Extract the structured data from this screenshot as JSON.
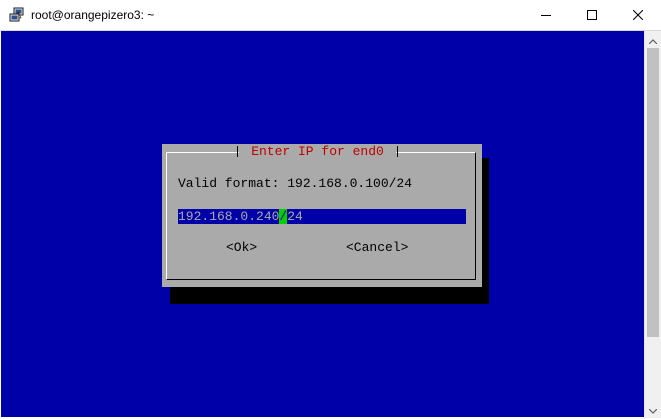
{
  "window": {
    "title": "root@orangepizero3: ~",
    "icon": "putty-icon",
    "controls": [
      "minimize-icon",
      "maximize-icon",
      "close-icon"
    ]
  },
  "dialog": {
    "title": "Enter IP for end0",
    "prompt": "Valid format: 192.168.0.100/24",
    "input_before_cursor": "192.168.0.240",
    "input_cursor_char": "/",
    "input_after_cursor": "24",
    "ok_label": "<Ok>",
    "cancel_label": "<Cancel>"
  },
  "colors": {
    "terminal_bg": "#0000a8",
    "dialog_bg": "#aaaaaa",
    "title_text": "#c00000",
    "cursor": "#00d000"
  }
}
